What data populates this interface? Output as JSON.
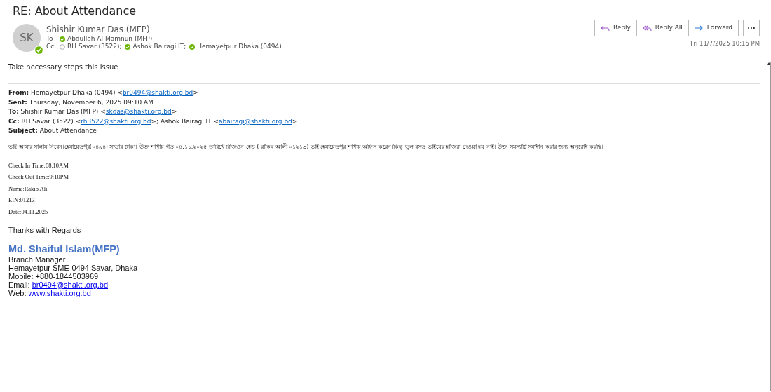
{
  "subject": "RE: About Attendance",
  "sender": {
    "initials": "SK",
    "name": "Shishir Kumar Das (MFP)",
    "online": true
  },
  "to": {
    "label": "To",
    "recipients": [
      {
        "name": "Abdullah Al Mamnun (MFP)",
        "online": true
      }
    ]
  },
  "cc": {
    "label": "Cc",
    "recipients": [
      {
        "name": "RH Savar (3522);",
        "online": false
      },
      {
        "name": "Ashok Bairagi IT;",
        "online": true
      },
      {
        "name": "Hemayetpur Dhaka (0494)",
        "online": true
      }
    ]
  },
  "actions": [
    {
      "kind": "reply",
      "label": "Reply"
    },
    {
      "kind": "reply_all",
      "label": "Reply All"
    },
    {
      "kind": "forward",
      "label": "Forward"
    },
    {
      "kind": "more",
      "label": "···"
    }
  ],
  "date": "Fri 11/7/2025 10:15 PM",
  "reply_text": "Take necessary steps this issue",
  "headers": [
    {
      "label": "From:",
      "parts": [
        {
          "kind": "text",
          "text": " Hemayetpur Dhaka (0494) <"
        },
        {
          "kind": "link",
          "text": "br0494@shakti.org.bd"
        },
        {
          "kind": "text",
          "text": ">"
        }
      ]
    },
    {
      "label": "Sent:",
      "parts": [
        {
          "kind": "text",
          "text": " Thursday, November 6, 2025 09:10 AM"
        }
      ]
    },
    {
      "label": "To:",
      "parts": [
        {
          "kind": "text",
          "text": " Shishir Kumar Das (MFP) <"
        },
        {
          "kind": "link",
          "text": "skdas@shakti.org.bd"
        },
        {
          "kind": "text",
          "text": ">"
        }
      ]
    },
    {
      "label": "Cc:",
      "parts": [
        {
          "kind": "text",
          "text": " RH Savar (3522) <"
        },
        {
          "kind": "link",
          "text": "rh3522@shakti.org.bd"
        },
        {
          "kind": "text",
          "text": ">; Ashok Bairagi IT <"
        },
        {
          "kind": "link",
          "text": "abairagi@shakti.org.bd"
        },
        {
          "kind": "text",
          "text": ">"
        }
      ]
    },
    {
      "label": "Subject:",
      "parts": [
        {
          "kind": "text",
          "text": " About Attendance"
        }
      ]
    }
  ],
  "body": "ভাই আমার সালাম নিবেন।হেমায়েতপুর(০৪৯৪) সাভার ঢাকা। উক্ত শাখায় গত ০৪.১১.২০২৫ তারিখে রিজিওন হেড ( রাকিব আলী ০১২১৩) ভাই হেমায়েতপুর শাখায় অফিস করেন।কিন্তু ভুল বসত ভাইয়ের হাজিরা দেওয়া হয় নাই। উক্ত সমস্যাটি সমাধান করার জন্য অনুরোধ করছি।",
  "details": [
    "Check In Time:08.10AM",
    "Check Out Time:9:10PM",
    "Name:Rakib Ali",
    "EIN:01213",
    "Date:04.11.2025"
  ],
  "closing": "Thanks with Regards",
  "signature": {
    "name": "Md. Shaiful Islam(MFP)",
    "lines": [
      {
        "parts": [
          {
            "kind": "text",
            "text": "Branch Manager"
          }
        ]
      },
      {
        "parts": [
          {
            "kind": "text",
            "text": "Hemayetpur SME-0494,Savar, Dhaka"
          }
        ]
      },
      {
        "parts": [
          {
            "kind": "text",
            "text": "Mobile: +880-1844503969"
          }
        ]
      },
      {
        "parts": [
          {
            "kind": "text",
            "text": "Email: "
          },
          {
            "kind": "link",
            "text": "br0494@shakti.org.bd"
          }
        ]
      },
      {
        "parts": [
          {
            "kind": "text",
            "text": "Web: "
          },
          {
            "kind": "link",
            "text": "www.shakti.org.bd"
          }
        ]
      }
    ]
  }
}
